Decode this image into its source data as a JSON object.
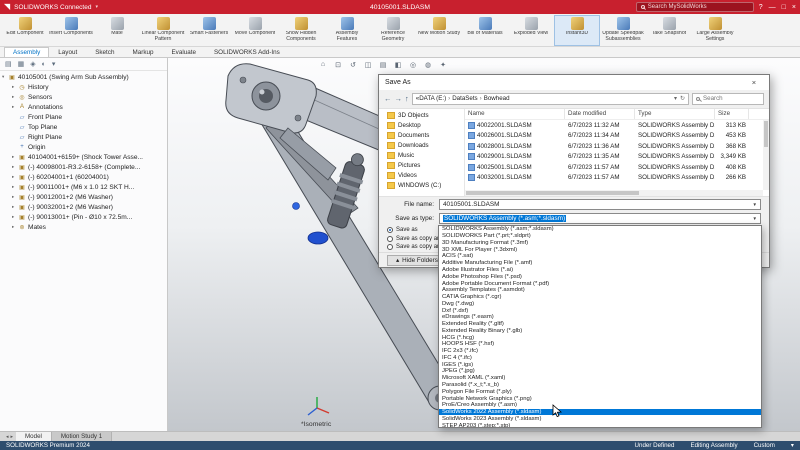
{
  "titlebar": {
    "app_name": "SOLIDWORKS Connected",
    "document_title": "40105001.SLDASM",
    "search_placeholder": "Search MySolidWorks",
    "help_glyph": "?",
    "minimize_glyph": "—",
    "restore_glyph": "□",
    "close_glyph": "×"
  },
  "ribbon": {
    "buttons": [
      {
        "name": "edit-component-button",
        "label": "Edit Component"
      },
      {
        "name": "insert-components-button",
        "label": "Insert Components"
      },
      {
        "name": "mate-button",
        "label": "Mate"
      },
      {
        "name": "linear-component-pattern-button",
        "label": "Linear Component Pattern"
      },
      {
        "name": "smart-fasteners-button",
        "label": "Smart Fasteners"
      },
      {
        "name": "move-component-button",
        "label": "Move Component"
      },
      {
        "name": "show-hidden-components-button",
        "label": "Show Hidden Components"
      },
      {
        "name": "assembly-features-button",
        "label": "Assembly Features"
      },
      {
        "name": "reference-geometry-button",
        "label": "Reference Geometry"
      },
      {
        "name": "new-motion-study-button",
        "label": "New Motion Study"
      },
      {
        "name": "bill-of-materials-button",
        "label": "Bill of Materials"
      },
      {
        "name": "exploded-view-button",
        "label": "Exploded View"
      },
      {
        "name": "instant3d-button",
        "label": "Instant3D",
        "active": true
      },
      {
        "name": "update-speedpak-button",
        "label": "Update Speedpak Subassemblies"
      },
      {
        "name": "take-snapshot-button",
        "label": "Take Snapshot"
      },
      {
        "name": "large-assembly-settings-button",
        "label": "Large Assembly Settings"
      }
    ],
    "tabs": [
      {
        "name": "tab-assembly",
        "label": "Assembly",
        "active": true
      },
      {
        "name": "tab-layout",
        "label": "Layout"
      },
      {
        "name": "tab-sketch",
        "label": "Sketch"
      },
      {
        "name": "tab-markup",
        "label": "Markup"
      },
      {
        "name": "tab-evaluate",
        "label": "Evaluate"
      },
      {
        "name": "tab-solidworks-add-ins",
        "label": "SOLIDWORKS Add-Ins"
      }
    ]
  },
  "panel": {
    "header_icons": [
      "▤",
      "▦",
      "◈",
      "◐",
      "▾"
    ],
    "tree": [
      {
        "name": "tree-item-root",
        "cls": "root",
        "arrow": "▾",
        "icon": "▣",
        "label": "40105001 (Swing Arm Sub Assembly)"
      },
      {
        "name": "tree-item-history",
        "arrow": "▸",
        "icon": "◷",
        "label": "History"
      },
      {
        "name": "tree-item-sensors",
        "arrow": "▸",
        "icon": "◎",
        "label": "Sensors"
      },
      {
        "name": "tree-item-annotations",
        "arrow": "▸",
        "icon": "A",
        "label": "Annotations"
      },
      {
        "name": "tree-item-front-plane",
        "arrow": "",
        "icon": "▱",
        "label": "Front Plane"
      },
      {
        "name": "tree-item-top-plane",
        "arrow": "",
        "icon": "▱",
        "label": "Top Plane"
      },
      {
        "name": "tree-item-right-plane",
        "arrow": "",
        "icon": "▱",
        "label": "Right Plane"
      },
      {
        "name": "tree-item-origin",
        "arrow": "",
        "icon": "+",
        "label": "Origin"
      },
      {
        "name": "tree-item-40104001",
        "arrow": "▸",
        "icon": "▣",
        "label": "40104001+6159+ (Shock Tower Asse..."
      },
      {
        "name": "tree-item-40098001",
        "arrow": "▸",
        "icon": "▣",
        "label": "(-) 40098001-R3.2-6158+ (Complete..."
      },
      {
        "name": "tree-item-60204001",
        "arrow": "▸",
        "icon": "▣",
        "label": "(-) 60204001+1 (60204001)"
      },
      {
        "name": "tree-item-90011001",
        "arrow": "▸",
        "icon": "▣",
        "label": "(-) 90011001+ (M6 x 1.0 12 SKT H..."
      },
      {
        "name": "tree-item-90012001",
        "arrow": "▸",
        "icon": "▣",
        "label": "(-) 90012001+2 (M6 Washer)"
      },
      {
        "name": "tree-item-90032001",
        "arrow": "▸",
        "icon": "▣",
        "label": "(-) 90032001+2 (M6 Washer)"
      },
      {
        "name": "tree-item-90013001",
        "arrow": "▸",
        "icon": "▣",
        "label": "(-) 90013001+ (Pin - Ø10 x 72.5m..."
      },
      {
        "name": "tree-item-mates",
        "arrow": "▸",
        "icon": "⊚",
        "label": "Mates"
      }
    ]
  },
  "viewport": {
    "view_label": "*Isometric",
    "hud_icons": [
      {
        "name": "zoom-fit-icon",
        "glyph": "⌂"
      },
      {
        "name": "zoom-area-icon",
        "glyph": "⊡"
      },
      {
        "name": "previous-view-icon",
        "glyph": "↺"
      },
      {
        "name": "section-view-icon",
        "glyph": "◫"
      },
      {
        "name": "view-orientation-icon",
        "glyph": "▤"
      },
      {
        "name": "display-style-icon",
        "glyph": "◧"
      },
      {
        "name": "hide-show-icon",
        "glyph": "◎"
      },
      {
        "name": "appearance-icon",
        "glyph": "◍"
      },
      {
        "name": "scene-icon",
        "glyph": "✦"
      }
    ]
  },
  "dialog": {
    "title": "Save As",
    "close_glyph": "×",
    "nav": {
      "back": "←",
      "forward": "→",
      "up": "↑",
      "overflow": "«",
      "dropdown": "▾",
      "refresh": "↻"
    },
    "breadcrumb": [
      {
        "label": "DATA (E:)"
      },
      {
        "label": "DataSets"
      },
      {
        "label": "Bowhead"
      }
    ],
    "search_placeholder": "Search",
    "folders": [
      {
        "name": "folder-3d-objects",
        "label": "3D Objects"
      },
      {
        "name": "folder-desktop",
        "label": "Desktop"
      },
      {
        "name": "folder-documents",
        "label": "Documents"
      },
      {
        "name": "folder-downloads",
        "label": "Downloads"
      },
      {
        "name": "folder-music",
        "label": "Music"
      },
      {
        "name": "folder-pictures",
        "label": "Pictures"
      },
      {
        "name": "folder-videos",
        "label": "Videos"
      },
      {
        "name": "folder-windows-c",
        "label": "WINDOWS (C:)"
      }
    ],
    "columns": {
      "name": "Name",
      "date": "Date modified",
      "type": "Type",
      "size": "Size"
    },
    "files": [
      {
        "name": "40022001.SLDASM",
        "date": "6/7/2023 11:32 AM",
        "type": "SOLIDWORKS Assembly D...",
        "size": "313 KB"
      },
      {
        "name": "40026001.SLDASM",
        "date": "6/7/2023 11:34 AM",
        "type": "SOLIDWORKS Assembly D...",
        "size": "453 KB"
      },
      {
        "name": "40028001.SLDASM",
        "date": "6/7/2023 11:36 AM",
        "type": "SOLIDWORKS Assembly D...",
        "size": "368 KB"
      },
      {
        "name": "40029001.SLDASM",
        "date": "6/7/2023 11:35 AM",
        "type": "SOLIDWORKS Assembly D...",
        "size": "3,349 KB"
      },
      {
        "name": "40025001.SLDASM",
        "date": "6/7/2023 11:57 AM",
        "type": "SOLIDWORKS Assembly D...",
        "size": "408 KB"
      },
      {
        "name": "40032001.SLDASM",
        "date": "6/7/2023 11:57 AM",
        "type": "SOLIDWORKS Assembly D...",
        "size": "266 KB"
      }
    ],
    "file_name_label": "File name:",
    "file_name_value": "40105001.SLDASM",
    "save_type_label": "Save as type:",
    "save_type_value": "SOLIDWORKS Assembly (*.asm;*.sldasm)",
    "options": [
      {
        "name": "radio-save-as",
        "label": "Save as",
        "checked": true
      },
      {
        "name": "radio-save-as-copy-continue",
        "label": "Save as copy and continue"
      },
      {
        "name": "radio-save-as-copy-open",
        "label": "Save as copy and open"
      }
    ],
    "hide_folders_label": "Hide Folders",
    "formats": [
      {
        "label": "SOLIDWORKS Assembly (*.asm;*.sldasm)"
      },
      {
        "label": "SOLIDWORKS Part (*.prt;*.sldprt)"
      },
      {
        "label": "3D Manufacturing Format (*.3mf)"
      },
      {
        "label": "3D XML For Player (*.3dxml)"
      },
      {
        "label": "ACIS (*.sat)"
      },
      {
        "label": "Additive Manufacturing File (*.amf)"
      },
      {
        "label": "Adobe Illustrator Files (*.ai)"
      },
      {
        "label": "Adobe Photoshop Files (*.psd)"
      },
      {
        "label": "Adobe Portable Document Format (*.pdf)"
      },
      {
        "label": "Assembly Templates (*.asmdot)"
      },
      {
        "label": "CATIA Graphics (*.cgr)"
      },
      {
        "label": "Dwg (*.dwg)"
      },
      {
        "label": "Dxf (*.dxf)"
      },
      {
        "label": "eDrawings (*.easm)"
      },
      {
        "label": "Extended Reality (*.gltf)"
      },
      {
        "label": "Extended Reality Binary (*.glb)"
      },
      {
        "label": "HCG (*.hcg)"
      },
      {
        "label": "HOOPS HSF (*.hsf)"
      },
      {
        "label": "IFC 2x3 (*.ifc)"
      },
      {
        "label": "IFC 4 (*.ifc)"
      },
      {
        "label": "IGES (*.igs)"
      },
      {
        "label": "JPEG (*.jpg)"
      },
      {
        "label": "Microsoft XAML (*.xaml)"
      },
      {
        "label": "Parasolid (*.x_t;*.x_b)"
      },
      {
        "label": "Polygon File Format (*.ply)"
      },
      {
        "label": "Portable Network Graphics (*.png)"
      },
      {
        "label": "ProE/Creo Assembly (*.asm)"
      },
      {
        "label": "SolidWorks 2022 Assembly (*.sldasm)",
        "selected": true
      },
      {
        "label": "SolidWorks 2023 Assembly (*.sldasm)"
      },
      {
        "label": "STEP AP203 (*.step;*.stp)"
      }
    ]
  },
  "bottom": {
    "tabs": [
      {
        "name": "tab-model",
        "label": "Model",
        "active": true
      },
      {
        "name": "tab-motion-study-1",
        "label": "Motion Study 1"
      }
    ]
  },
  "statusbar": {
    "left": "SOLIDWORKS Premium 2024",
    "items": [
      {
        "label": "Under Defined"
      },
      {
        "label": "Editing Assembly"
      },
      {
        "label": "Custom"
      }
    ],
    "caret": "▾"
  },
  "colors": {
    "brand_red": "#c8202e",
    "selection_blue": "#0078d7",
    "accent_blue": "#0072c6",
    "statusbar_blue": "#2e4d6e"
  }
}
